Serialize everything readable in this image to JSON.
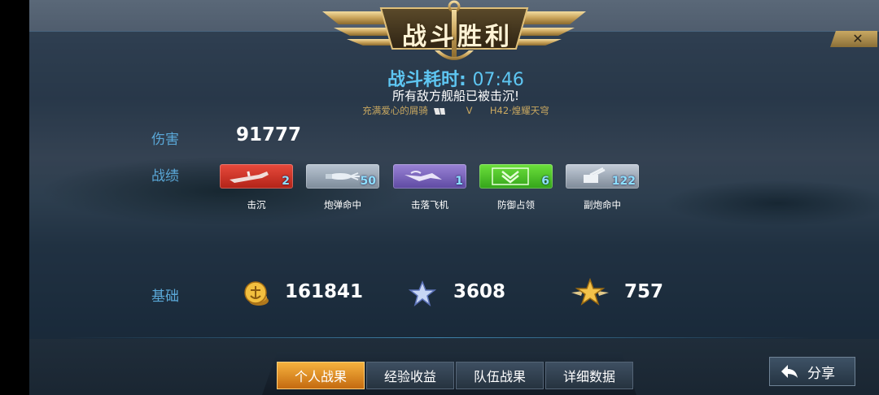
{
  "header": {
    "title": "战斗胜利",
    "close_symbol": "✕"
  },
  "summary": {
    "time_label": "战斗耗时:",
    "time_value": "07:46",
    "message": "所有敌方舰船已被击沉!",
    "player_name": "充满爱心的屑骑",
    "player_tag": "V",
    "ship_name": "H42·煌耀天穹"
  },
  "damage": {
    "label": "伤害",
    "value": "91777"
  },
  "achievements": {
    "label": "战绩",
    "items": [
      {
        "name": "击沉",
        "count": "2",
        "color": "#d8392b",
        "icon": "sinking-ship-icon"
      },
      {
        "name": "炮弹命中",
        "count": "50",
        "color": "#9aa8b6",
        "icon": "shell-hit-icon"
      },
      {
        "name": "击落飞机",
        "count": "1",
        "color": "#7a66c0",
        "icon": "plane-downed-icon"
      },
      {
        "name": "防御占领",
        "count": "6",
        "color": "#4cc22a",
        "icon": "defend-capture-icon"
      },
      {
        "name": "副炮命中",
        "count": "122",
        "color": "#a3aebc",
        "icon": "secondary-gun-icon"
      }
    ]
  },
  "base": {
    "label": "基础",
    "resources": [
      {
        "icon": "gold-coins-icon",
        "value": "161841"
      },
      {
        "icon": "blue-star-icon",
        "value": "3608"
      },
      {
        "icon": "winged-gold-star-icon",
        "value": "757"
      }
    ]
  },
  "tabs": [
    {
      "label": "个人战果",
      "active": true
    },
    {
      "label": "经验收益",
      "active": false
    },
    {
      "label": "队伍战果",
      "active": false
    },
    {
      "label": "详细数据",
      "active": false
    }
  ],
  "share": {
    "label": "分享"
  }
}
